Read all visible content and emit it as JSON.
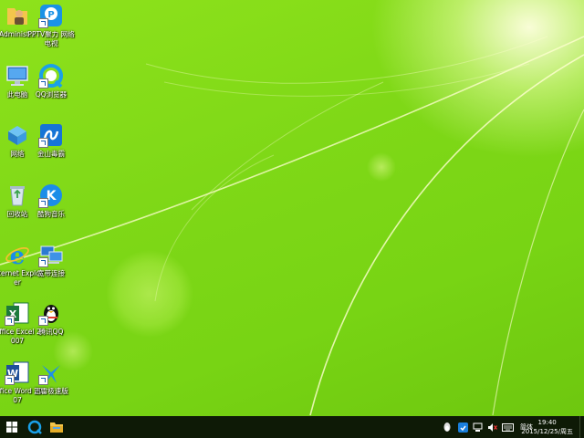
{
  "desktop": {
    "icons": [
      {
        "label": "Administ...",
        "icon": "user-folder-icon"
      },
      {
        "label": "PPTV聚力 网络电视",
        "icon": "pptv-icon"
      },
      {
        "label": "此电脑",
        "icon": "computer-icon"
      },
      {
        "label": "QQ浏览器",
        "icon": "qq-browser-icon"
      },
      {
        "label": "网络",
        "icon": "network-icon"
      },
      {
        "label": "金山毒霸",
        "icon": "kingsoft-antivirus-icon"
      },
      {
        "label": "回收站",
        "icon": "recycle-bin-icon"
      },
      {
        "label": "酷狗音乐",
        "icon": "kugou-music-icon"
      },
      {
        "label": "Internet Explorer",
        "icon": "internet-explorer-icon"
      },
      {
        "label": "宽带连接",
        "icon": "broadband-connection-icon"
      },
      {
        "label": "Office Excel 2007",
        "icon": "excel-icon"
      },
      {
        "label": "腾讯QQ",
        "icon": "qq-penguin-icon"
      },
      {
        "label": "Office Word 2007",
        "icon": "word-icon"
      },
      {
        "label": "迅雷极速版",
        "icon": "xunlei-icon"
      }
    ]
  },
  "taskbar": {
    "start": "windows-start-icon",
    "pinned": [
      "qq-browser-icon",
      "file-explorer-icon"
    ],
    "tray": {
      "ime": "简体",
      "time": "19:40",
      "date": "2015/12/25/周五"
    }
  },
  "colors": {
    "wallpaper": "#7fd817",
    "taskbar": "#0e1a06"
  }
}
